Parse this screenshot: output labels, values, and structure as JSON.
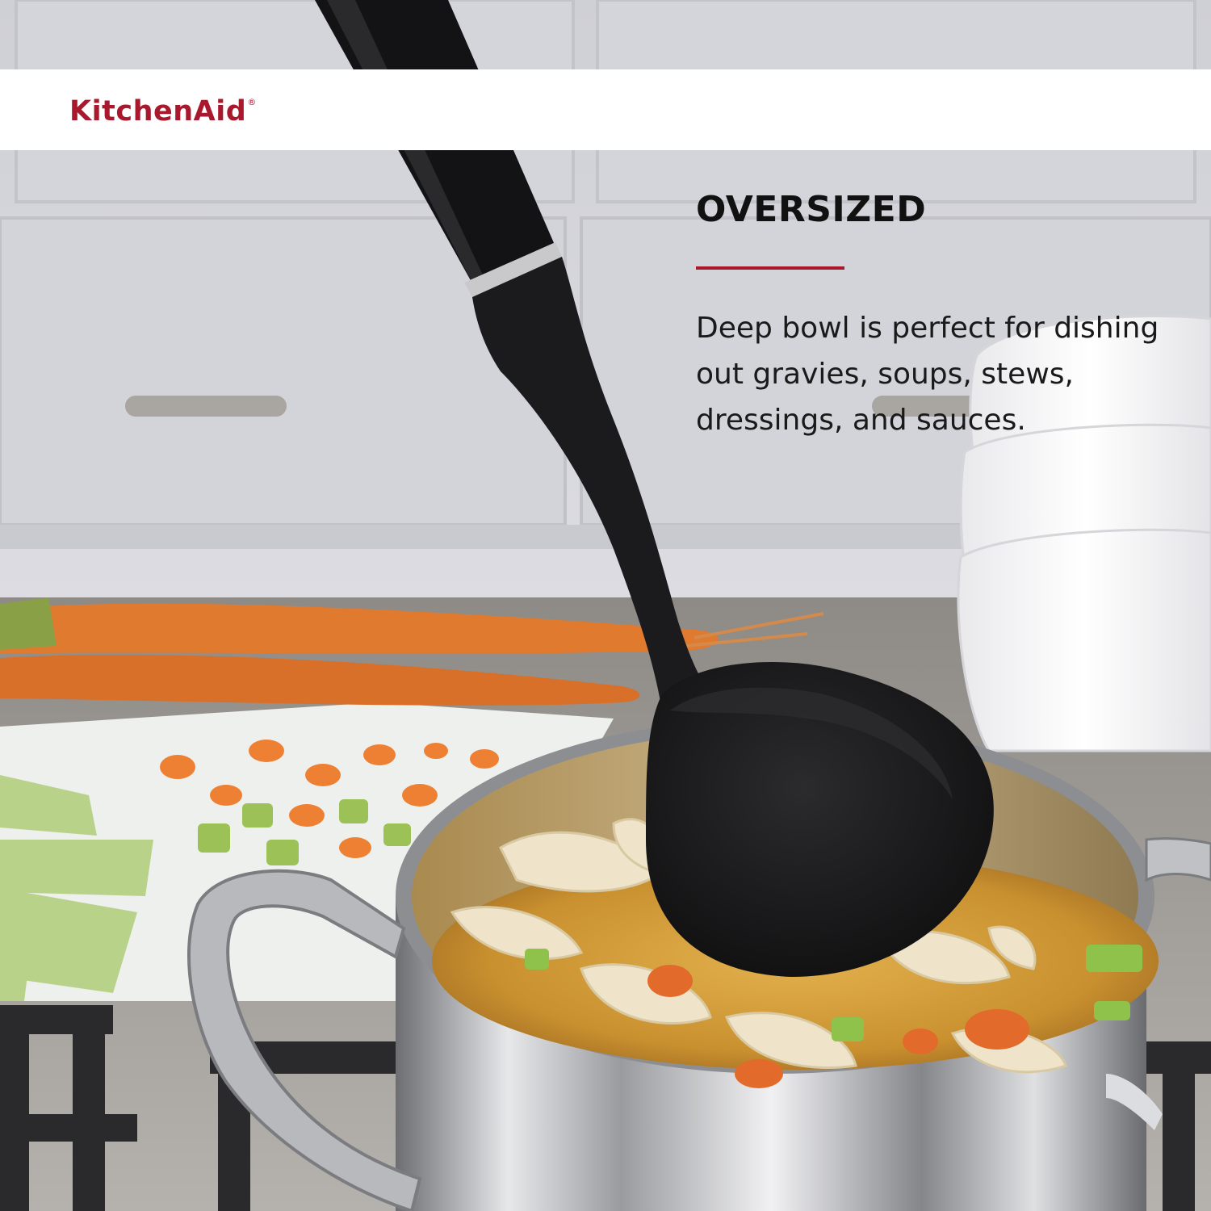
{
  "brand": {
    "name": "KitchenAid",
    "mark": "®"
  },
  "feature": {
    "title": "OVERSIZED",
    "description": "Deep bowl is perfect for dishing out gravies, soups, stews, dressings, and sauces."
  },
  "colors": {
    "brand_red": "#a8192e",
    "ladle": "#1c1c1e",
    "banner": "#ffffff"
  }
}
